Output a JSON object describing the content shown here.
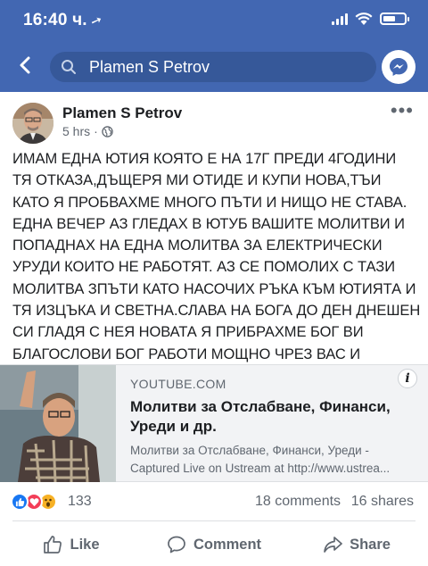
{
  "status_bar": {
    "time": "16:40 ч.",
    "location_glyph": "➚"
  },
  "search": {
    "query": "Plamen S Petrov"
  },
  "post": {
    "author": "Plamen S Petrov",
    "time": "5 hrs",
    "separator": "·",
    "more_glyph": "•••",
    "text": "ИМАМ ЕДНА ЮТИЯ КОЯТО Е НА 17Г ПРЕДИ 4ГОДИНИ\nТЯ ОТКАЗА,ДЪЩЕРЯ МИ ОТИДЕ И КУПИ НОВА,ТЪИ\nКАТО Я ПРОБВАХМЕ МНОГО ПЪТИ И НИЩО НЕ СТАВА.\nЕДНА ВЕЧЕР АЗ ГЛЕДАХ В ЮТУБ ВАШИТЕ МОЛИТВИ И\nПОПАДНАХ НА ЕДНА МОЛИТВА ЗА ЕЛЕКТРИЧЕСКИ\nУРУДИ КОИТО НЕ РАБОТЯТ. АЗ СЕ ПОМОЛИХ С ТАЗИ\nМОЛИТВА ЗПЪТИ КАТО НАСОЧИХ РЪКА КЪМ ЮТИЯТА И\nТЯ ИЗЦЪКА И СВЕТНА.СЛАВА НА БОГА ДО ДЕН ДНЕШЕН\nСИ ГЛАДЯ С НЕЯ НОВАТА Я ПРИБРАХМЕ БОГ ВИ\nБЛАГОСЛОВИ БОГ РАБОТИ МОЩНО ЧРЕЗ ВАС И\nВАШИТЕ МОЛИТВИ. ДАРИНА"
  },
  "link_preview": {
    "domain": "YOUTUBE.COM",
    "title": "Молитви за Отслабване, Финанси, Уреди и др.",
    "description_line1": "Молитви за Отслабване, Финанси, Уреди -",
    "description_line2": "Captured Live on Ustream at http://www.ustrea...",
    "info_glyph": "i"
  },
  "engagement": {
    "reaction_count": "133",
    "comments": "18 comments",
    "shares": "16 shares",
    "reaction_icons": [
      "like-icon",
      "love-icon",
      "wow-icon"
    ]
  },
  "actions": {
    "like": "Like",
    "comment": "Comment",
    "share": "Share"
  },
  "colors": {
    "facebook_blue": "#4267b2",
    "search_bg": "#365899",
    "secondary_text": "#606770",
    "like_blue": "#1877f2",
    "love_red": "#f33e58",
    "wow_yellow": "#f7b125"
  }
}
